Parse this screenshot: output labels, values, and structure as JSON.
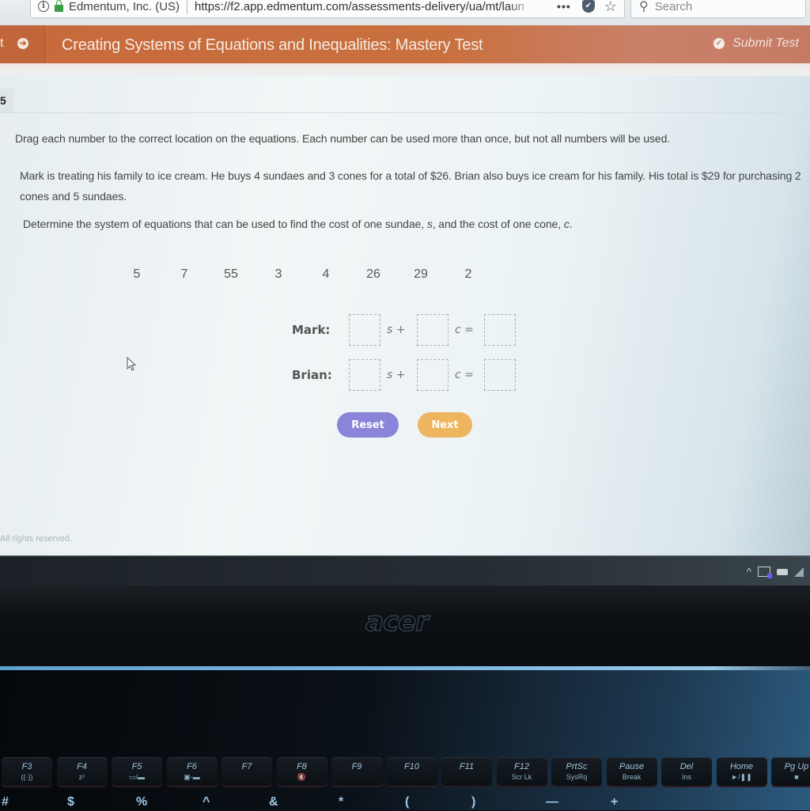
{
  "browser": {
    "site_identity": "Edmentum, Inc. (US)",
    "url": "https://f2.app.edmentum.com/assessments-delivery/ua/mt/laun",
    "more_menu": "•••",
    "search_placeholder": "Search"
  },
  "header": {
    "back_label": "t",
    "title": "Creating Systems of Equations and Inequalities: Mastery Test",
    "submit_label": "Submit Test",
    "color": "#c86a3c"
  },
  "question": {
    "number": "5",
    "instructions": "Drag each number to the correct location on the equations. Each number can be used more than once, but not all numbers will be used.",
    "problem": "Mark is treating his family to ice cream. He buys 4 sundaes and 3 cones for a total of $26. Brian also buys ice cream for his family. His total is $29 for purchasing 2 cones and 5 sundaes.",
    "task_prefix": "Determine the system of equations that can be used to find the cost of one sundae, ",
    "task_var_s": "s",
    "task_middle": ", and the cost of one cone, ",
    "task_var_c": "c",
    "task_suffix": ".",
    "number_tiles": [
      "5",
      "7",
      "55",
      "3",
      "4",
      "26",
      "29",
      "2"
    ],
    "equations": [
      {
        "label": "Mark:",
        "var1": "s",
        "op1": "+",
        "var2": "c",
        "op2": "=",
        "slots": [
          "",
          "",
          ""
        ]
      },
      {
        "label": "Brian:",
        "var1": "s",
        "op1": "+",
        "var2": "c",
        "op2": "=",
        "slots": [
          "",
          "",
          ""
        ]
      }
    ]
  },
  "buttons": {
    "reset": "Reset",
    "next": "Next",
    "reset_color": "#8a85d8",
    "next_color": "#efb45e"
  },
  "footer": {
    "text": "All rights reserved."
  },
  "taskbar": {
    "tray_chevron": "^"
  },
  "laptop": {
    "brand": "acer",
    "function_keys": [
      {
        "label": "F3",
        "sub": "((·))"
      },
      {
        "label": "F4",
        "sub": "zᶻ"
      },
      {
        "label": "F5",
        "sub": "▭/▬"
      },
      {
        "label": "F6",
        "sub": "▣-▬"
      },
      {
        "label": "F7",
        "sub": ""
      },
      {
        "label": "F8",
        "sub": "🔇"
      },
      {
        "label": "F9",
        "sub": ""
      },
      {
        "label": "F10",
        "sub": ""
      },
      {
        "label": "F11",
        "sub": ""
      },
      {
        "label": "F12",
        "sub": "Scr Lk"
      },
      {
        "label": "PrtSc",
        "sub": "SysRq"
      },
      {
        "label": "Pause",
        "sub": "Break"
      },
      {
        "label": "Del",
        "sub": "Ins"
      },
      {
        "label": "Home",
        "sub": "►/❚❚"
      },
      {
        "label": "Pg Up",
        "sub": "■"
      }
    ],
    "symbol_keys": [
      "#",
      "$",
      "%",
      "^",
      "&",
      "*",
      "(",
      ")",
      "—",
      "+"
    ]
  }
}
